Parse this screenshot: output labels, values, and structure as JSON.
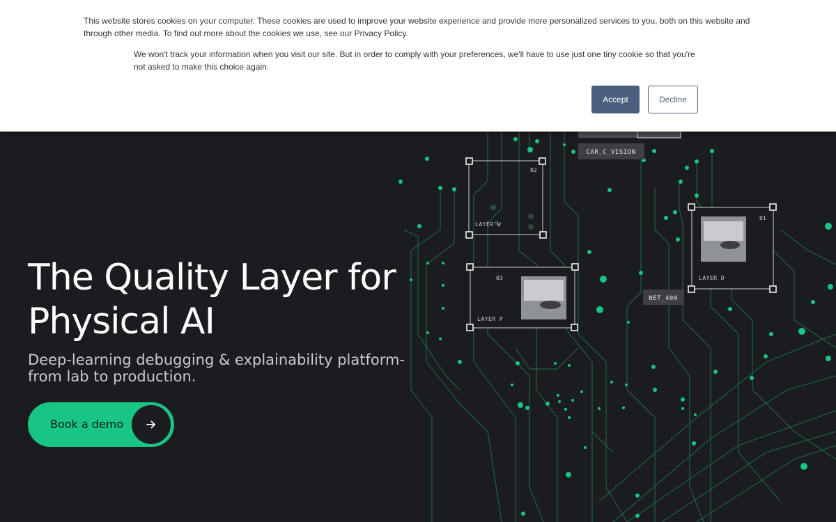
{
  "cookie_banner": {
    "text": "This website stores cookies on your computer. These cookies are used to improve your website experience and provide more personalized services to you, both on this website and through other media. To find out more about the cookies we use, see our Privacy Policy.",
    "secondary_text": "We won't track your information when you visit our site. But in order to comply with your preferences, we'll have to use just one tiny cookie so that you're not asked to make this choice again.",
    "accept_label": "Accept",
    "decline_label": "Decline",
    "accept_color": "#4a5f7d"
  },
  "hero": {
    "headline": "The Quality Layer for Physical AI",
    "subheadline": "Deep-learning debugging & explainability platform- from lab to production.",
    "cta_label": "Book a demo",
    "cta_icon": "arrow-right-icon",
    "accent_color": "#19c585",
    "background_color": "#1b1c20"
  },
  "graphic": {
    "tags": {
      "car_c_vision": "CAR_C_VISION",
      "net_400": "NET_400"
    },
    "boxes": {
      "layer_w": {
        "label": "LAYER W",
        "number": "02"
      },
      "layer_p": {
        "label": "LAYER P",
        "number": "03"
      },
      "layer_d": {
        "label": "LAYER D",
        "number": "01"
      }
    }
  }
}
